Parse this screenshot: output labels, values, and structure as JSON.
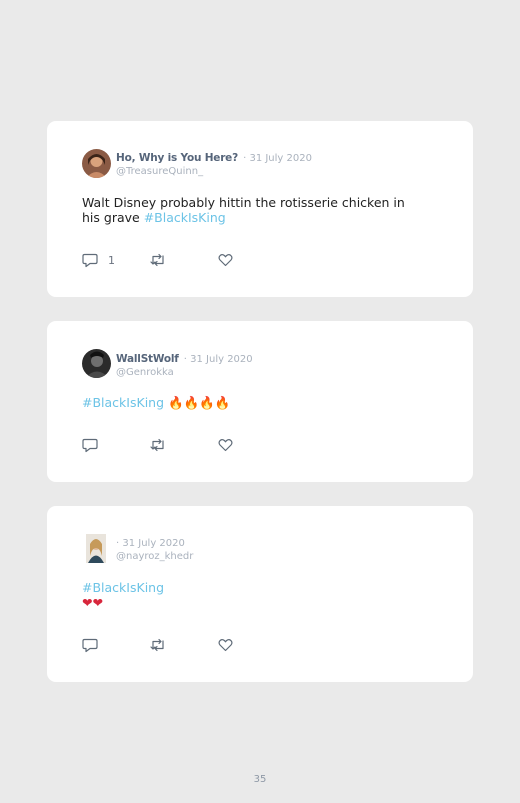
{
  "tweets": [
    {
      "name": "Ho, Why is You Here?",
      "date": "· 31 July 2020",
      "handle": "@TreasureQuinn_",
      "text": "Walt Disney probably hittin the rotisserie chicken in his grave ",
      "hashtag": "#BlackIsKing",
      "emoji": "",
      "reply_count": "1"
    },
    {
      "name": "WallStWolf",
      "date": "· 31 July 2020",
      "handle": "@Genrokka",
      "text": "",
      "hashtag": "#BlackIsKing",
      "emoji": "🔥🔥🔥🔥",
      "reply_count": ""
    },
    {
      "name": "",
      "date": "· 31 July 2020",
      "handle": "@nayroz_khedr",
      "text": "",
      "hashtag": "#BlackIsKing",
      "emoji": "❤❤",
      "reply_count": ""
    }
  ],
  "page_number": "35",
  "icons": {
    "reply": "comment-icon",
    "retweet": "retweet-icon",
    "like": "heart-icon"
  },
  "colors": {
    "hashtag": "#6cc3e6",
    "background": "#eaeaea",
    "fire": "#f0a020",
    "heart": "#d8263c"
  }
}
